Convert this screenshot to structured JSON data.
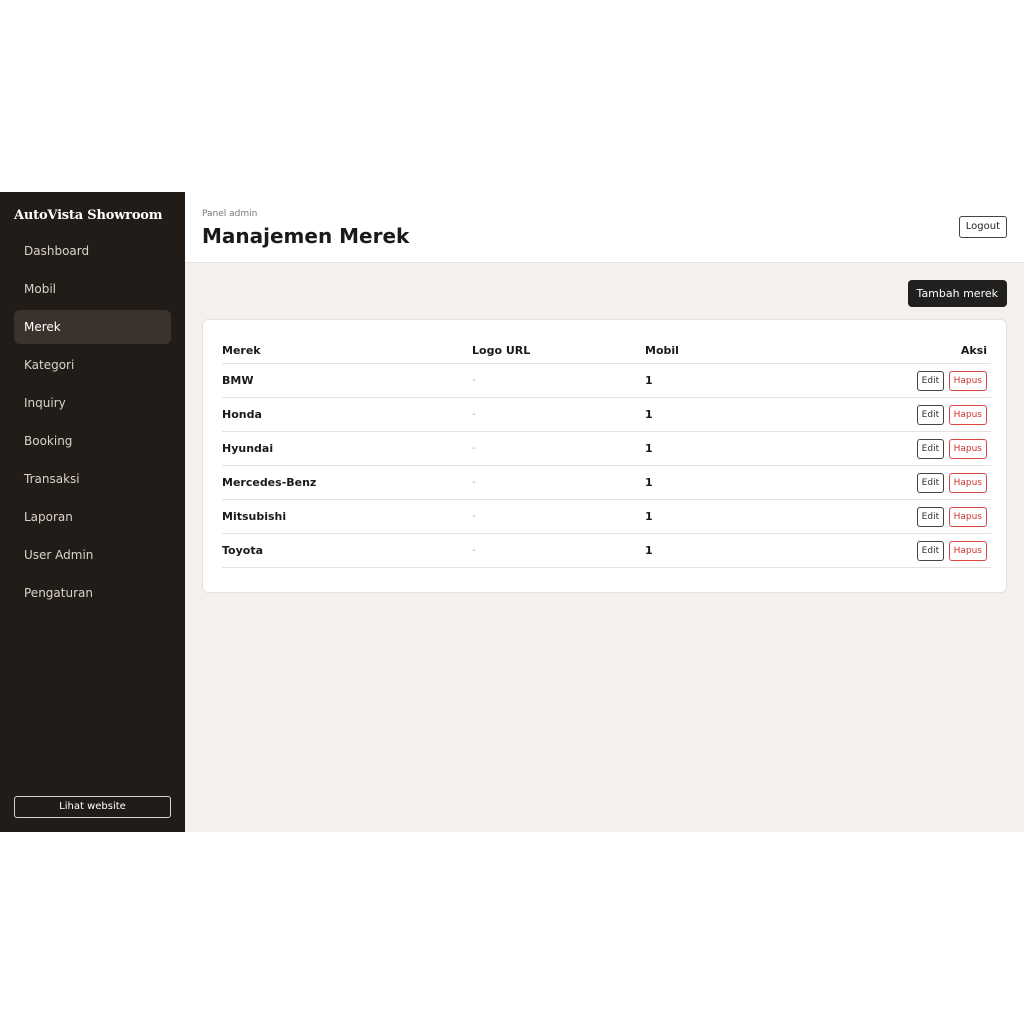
{
  "sidebar": {
    "brand": "AutoVista Showroom",
    "items": [
      {
        "label": "Dashboard"
      },
      {
        "label": "Mobil"
      },
      {
        "label": "Merek"
      },
      {
        "label": "Kategori"
      },
      {
        "label": "Inquiry"
      },
      {
        "label": "Booking"
      },
      {
        "label": "Transaksi"
      },
      {
        "label": "Laporan"
      },
      {
        "label": "User Admin"
      },
      {
        "label": "Pengaturan"
      }
    ],
    "active": "Merek",
    "site_button": "Lihat website"
  },
  "header": {
    "eyebrow": "Panel admin",
    "title": "Manajemen Merek",
    "logout": "Logout"
  },
  "toolbar": {
    "add_label": "Tambah merek"
  },
  "table": {
    "columns": [
      "Merek",
      "Logo URL",
      "Mobil",
      "Aksi"
    ],
    "rows": [
      {
        "name": "BMW",
        "logo": "-",
        "count": "1"
      },
      {
        "name": "Honda",
        "logo": "-",
        "count": "1"
      },
      {
        "name": "Hyundai",
        "logo": "-",
        "count": "1"
      },
      {
        "name": "Mercedes-Benz",
        "logo": "-",
        "count": "1"
      },
      {
        "name": "Mitsubishi",
        "logo": "-",
        "count": "1"
      },
      {
        "name": "Toyota",
        "logo": "-",
        "count": "1"
      }
    ],
    "edit_label": "Edit",
    "delete_label": "Hapus"
  },
  "colors": {
    "sidebar_bg": "#221c18",
    "main_bg": "#f4f1ec",
    "primary_button": "#22201e",
    "danger": "#cc3333"
  }
}
